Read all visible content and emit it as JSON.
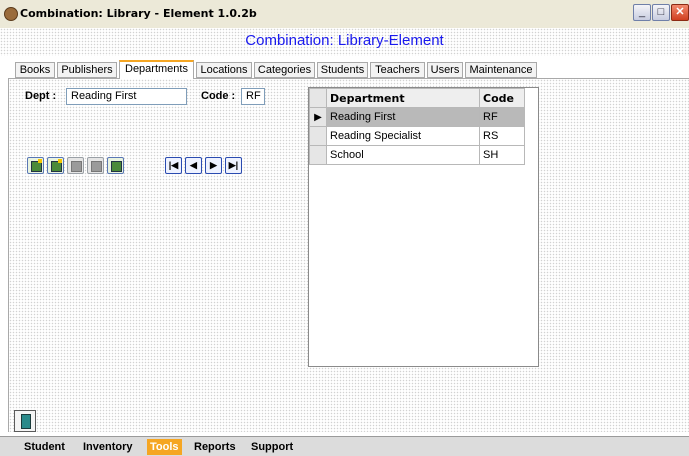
{
  "window": {
    "title": "Combination: Library - Element 1.0.2b",
    "header": "Combination:  Library-Element"
  },
  "tabs": [
    {
      "label": "Books"
    },
    {
      "label": "Publishers"
    },
    {
      "label": "Departments",
      "active": true
    },
    {
      "label": "Locations"
    },
    {
      "label": "Categories"
    },
    {
      "label": "Students"
    },
    {
      "label": "Teachers"
    },
    {
      "label": "Users"
    },
    {
      "label": "Maintenance"
    }
  ],
  "form": {
    "dept_label": "Dept :",
    "dept_value": "Reading First",
    "code_label": "Code :",
    "code_value": "RF"
  },
  "record_nav": {
    "first": "first-record-icon",
    "previous": "previous-record-icon",
    "next": "next-record-icon",
    "last": "last-record-icon"
  },
  "grid": {
    "columns": [
      "Department",
      "Code"
    ],
    "rows": [
      {
        "department": "Reading First",
        "code": "RF",
        "selected": true,
        "indicator": "▶"
      },
      {
        "department": "Reading Specialist",
        "code": "RS",
        "selected": false,
        "indicator": ""
      },
      {
        "department": "School",
        "code": "SH",
        "selected": false,
        "indicator": ""
      }
    ]
  },
  "bottom_tabs": [
    {
      "label": "Student"
    },
    {
      "label": "Inventory"
    },
    {
      "label": "Tools",
      "active": true
    },
    {
      "label": "Reports"
    },
    {
      "label": "Support"
    }
  ],
  "colors": {
    "header_text": "#1a1aee",
    "active_tab_accent": "#f5a623",
    "selected_row": "#b9b9b9"
  }
}
